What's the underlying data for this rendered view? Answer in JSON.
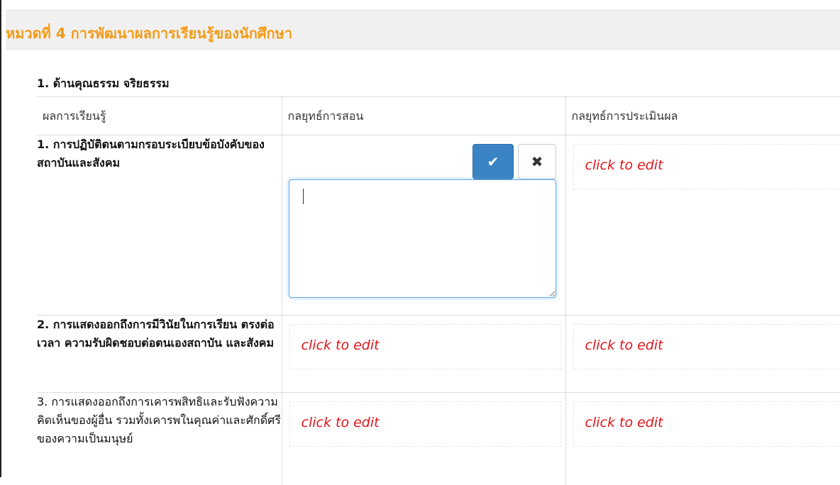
{
  "page": {
    "heading": "หมวดที่ 4 การพัฒนาผลการเรียนรู้ของนักศึกษา",
    "section_title": "1. ด้านคุณธรรม จริยธรรม"
  },
  "table": {
    "headers": [
      "ผลการเรียนรู้",
      "กลยุทธ์การสอน",
      "กลยุทธ์การประเมินผล"
    ],
    "rows": [
      {
        "outcome": "1. การปฏิบัติตนตามกรอบระเบียบข้อบังคับของสถาบันและสังคม",
        "teaching": "",
        "assessment": "click to edit"
      },
      {
        "outcome": "2. การแสดงออกถึงการมีวินัยในการเรียน ตรงต่อเวลา ความรับผิดชอบต่อตนเองสถาบัน และสังคม",
        "teaching": "click to edit",
        "assessment": "click to edit"
      },
      {
        "outcome": "3. การแสดงออกถึงการเคารพสิทธิและรับฟังความคิดเห็นของผู้อื่น รวมทั้งเคารพในคุณค่าและศักดิ์ศรีของความเป็นมนุษย์",
        "teaching": "click to edit",
        "assessment": "click to edit"
      }
    ]
  },
  "editor": {
    "value": "",
    "confirm_icon": "check-icon",
    "cancel_icon": "times-icon"
  },
  "colors": {
    "heading": "#f39b16",
    "placeholder": "#e0151b",
    "confirm_button": "#3b84c4",
    "focus_border": "#66afe9"
  }
}
